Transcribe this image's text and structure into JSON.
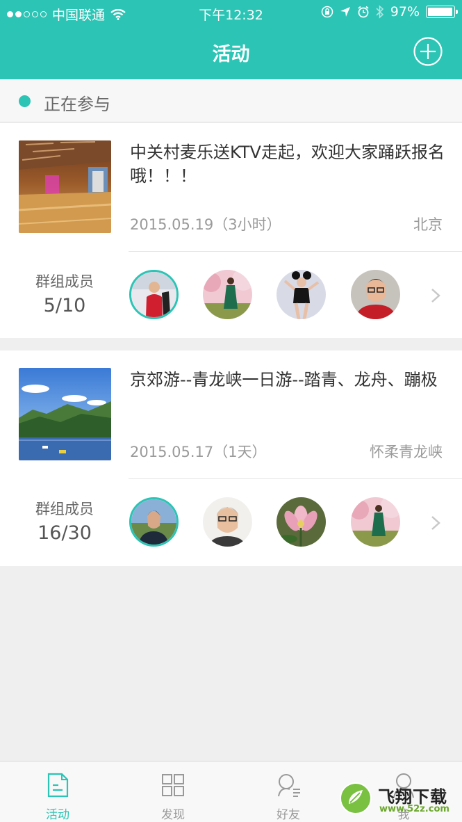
{
  "status_bar": {
    "carrier": "中国联通",
    "time": "下午12:32",
    "battery": "97%",
    "battery_level": 0.97
  },
  "nav": {
    "title": "活动",
    "add_icon": "plus-circle-icon"
  },
  "section": {
    "label": "正在参与"
  },
  "activities": [
    {
      "title": "中关村麦乐送KTV走起，欢迎大家踊跃报名哦！！！",
      "date": "2015.05.19（3小时）",
      "location": "北京",
      "members_label": "群组成员",
      "members_count": "5/10",
      "thumb": "ktv-room-photo",
      "avatars": [
        "person-snow",
        "woman-blossom",
        "woman-ears",
        "man-glasses"
      ]
    },
    {
      "title": "京郊游--青龙峡一日游--踏青、龙舟、蹦极",
      "date": "2015.05.17（1天）",
      "location": "怀柔青龙峡",
      "members_label": "群组成员",
      "members_count": "16/30",
      "thumb": "lake-mountain-photo",
      "avatars": [
        "man-outdoor",
        "man-glasses-2",
        "lotus-flower",
        "woman-blossom"
      ]
    }
  ],
  "tabs": [
    {
      "label": "活动",
      "icon": "document-icon",
      "active": true
    },
    {
      "label": "发现",
      "icon": "grid-icon",
      "active": false
    },
    {
      "label": "好友",
      "icon": "friends-icon",
      "active": false
    },
    {
      "label": "我",
      "icon": "profile-icon",
      "active": false
    }
  ],
  "watermark": {
    "brand": "飞翔下载",
    "site": "www.52z.com"
  },
  "colors": {
    "accent": "#2bc4b5",
    "background": "#efefef"
  }
}
